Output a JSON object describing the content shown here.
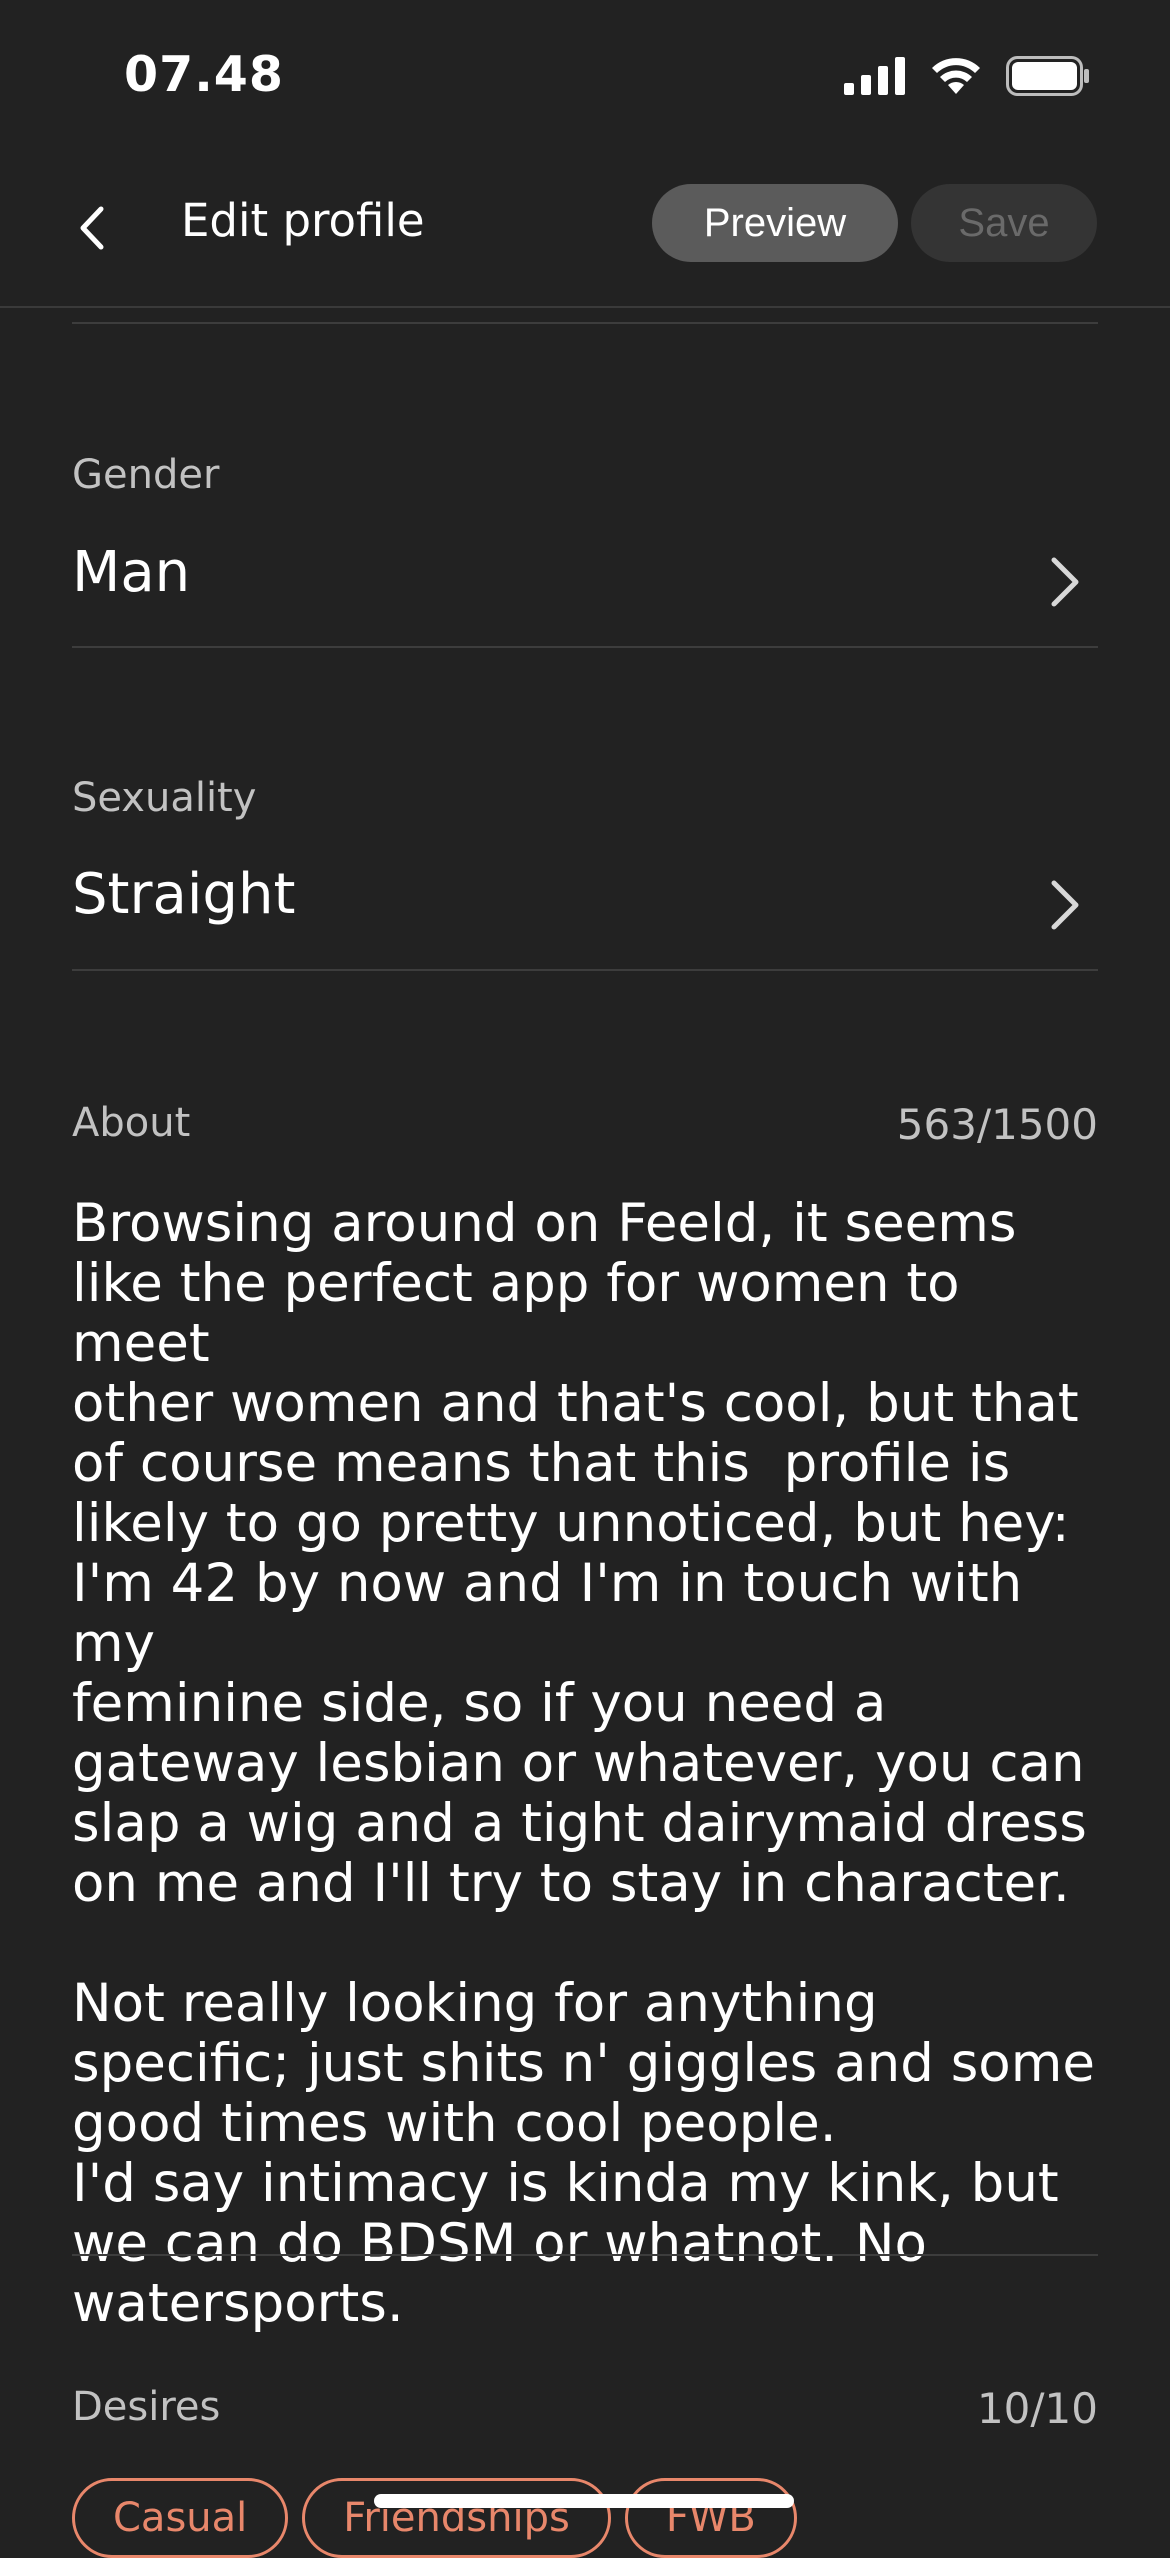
{
  "status_bar": {
    "time": "07.48",
    "icons": [
      "cellular-signal-icon",
      "wifi-icon",
      "battery-icon"
    ]
  },
  "header": {
    "back_icon": "chevron-left-icon",
    "title": "Edit profile",
    "preview_label": "Preview",
    "save_label": "Save"
  },
  "fields": {
    "gender": {
      "label": "Gender",
      "value": "Man"
    },
    "sexuality": {
      "label": "Sexuality",
      "value": "Straight"
    },
    "about": {
      "label": "About",
      "counter": "563/1500",
      "text": "Browsing around on Feeld, it seems\nlike the perfect app for women to meet\nother women and that's cool, but that\nof course means that this  profile is\nlikely to go pretty unnoticed, but hey:\nI'm 42 by now and I'm in touch with my\nfeminine side, so if you need a\ngateway lesbian or whatever, you can\nslap a wig and a tight dairymaid dress\non me and I'll try to stay in character.\n\nNot really looking for anything\nspecific; just shits n' giggles and some\ngood times with cool people.\nI'd say intimacy is kinda my kink, but\nwe can do BDSM or whatnot. No\nwatersports."
    },
    "desires": {
      "label": "Desires",
      "counter": "10/10",
      "chips": [
        "Casual",
        "Friendships",
        "FWB"
      ]
    }
  },
  "colors": {
    "background": "#222222",
    "accent": "#e8876b",
    "preview_bg": "#5b5b5b",
    "save_bg": "#343434"
  }
}
